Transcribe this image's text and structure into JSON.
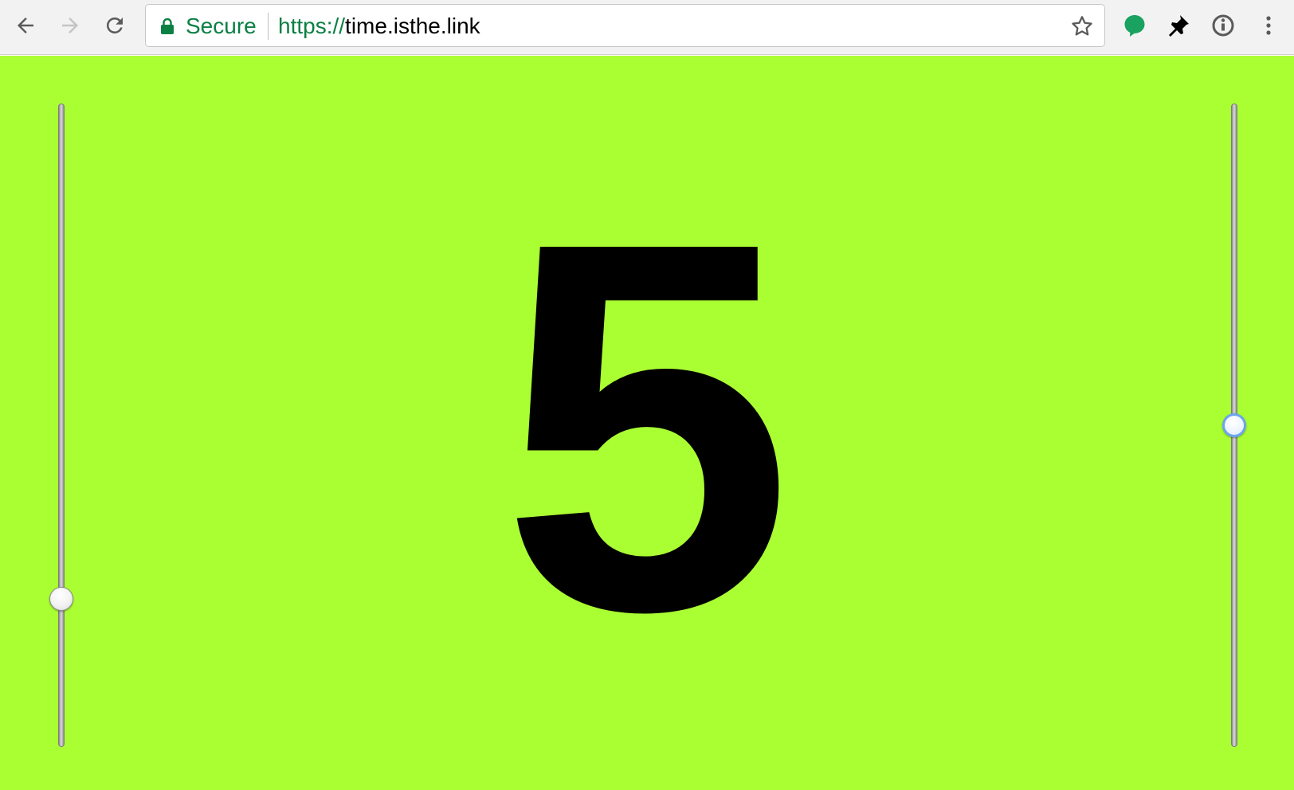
{
  "browser": {
    "security_label": "Secure",
    "url_scheme": "https://",
    "url_host": "time.isthe.link",
    "icons": {
      "back": "back-arrow-icon",
      "forward": "forward-arrow-icon",
      "reload": "reload-icon",
      "lock": "lock-icon",
      "bookmark": "star-icon",
      "ext1": "speech-bubble-icon",
      "ext2": "pushpin-icon",
      "ext3": "info-circle-icon",
      "menu": "vertical-dots-icon"
    },
    "colors": {
      "secure_green": "#0b8043",
      "ext_bubble_green": "#1aa260"
    }
  },
  "page": {
    "background_color": "#aaff33",
    "display_value": "5",
    "left_slider": {
      "value_fraction": 0.23
    },
    "right_slider": {
      "value_fraction": 0.5,
      "focused": true
    }
  }
}
